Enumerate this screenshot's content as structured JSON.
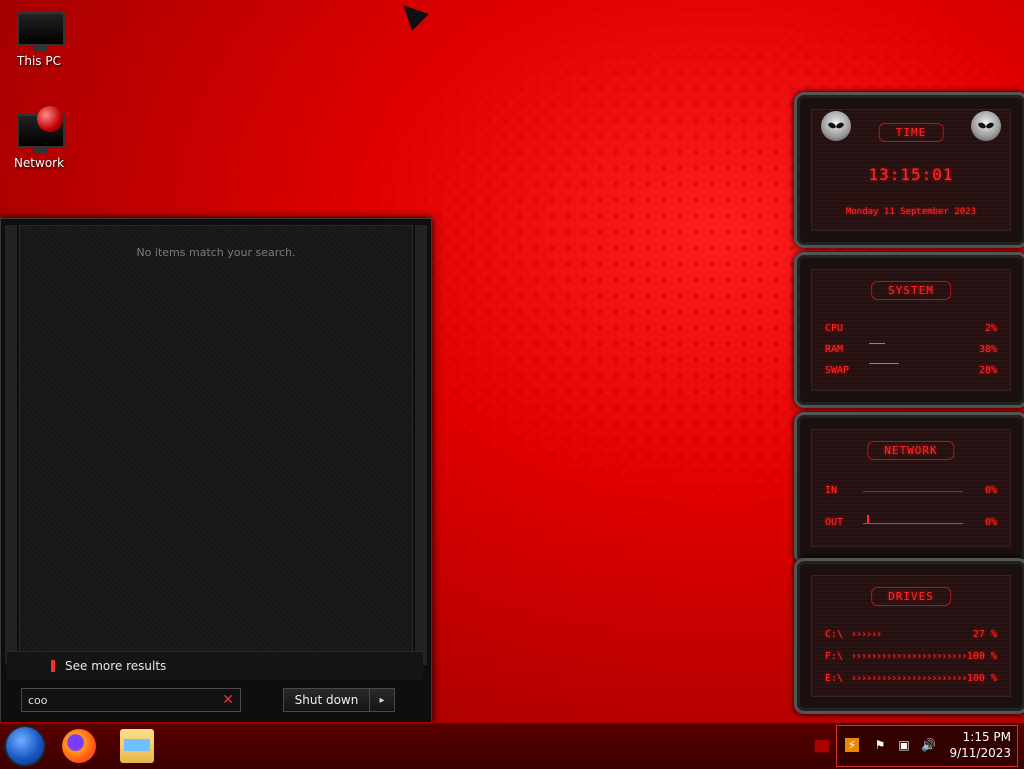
{
  "desktop": {
    "icons": [
      {
        "label": "This PC",
        "icon": "monitor-icon"
      },
      {
        "label": "Network",
        "icon": "network-icon"
      }
    ]
  },
  "start_menu": {
    "no_results": "No items match your search.",
    "see_more": "See more results",
    "search": {
      "value": "coo",
      "clear_icon": "close-icon"
    },
    "shutdown_label": "Shut down",
    "shutdown_arrow": "▸"
  },
  "gadgets": {
    "time": {
      "title": "TIME",
      "clock": "13:15:01",
      "date": "Monday 11 September 2023"
    },
    "system": {
      "title": "SYSTEM",
      "rows": [
        {
          "label": "CPU",
          "value": "2%"
        },
        {
          "label": "RAM",
          "value": "38%"
        },
        {
          "label": "SWAP",
          "value": "28%"
        }
      ]
    },
    "network": {
      "title": "NETWORK",
      "rows": [
        {
          "label": "IN",
          "value": "0%"
        },
        {
          "label": "OUT",
          "value": "0%"
        }
      ]
    },
    "drives": {
      "title": "DRIVES",
      "rows": [
        {
          "label": "C:\\",
          "value": "27 %"
        },
        {
          "label": "F:\\",
          "value": "100 %"
        },
        {
          "label": "E:\\",
          "value": "100 %"
        }
      ]
    }
  },
  "taskbar": {
    "time": "1:15 PM",
    "date": "9/11/2023"
  },
  "colors": {
    "accent": "#ff2a2a",
    "taskbar": "#3a0000",
    "start_menu_bg": "#0e0e0e"
  }
}
